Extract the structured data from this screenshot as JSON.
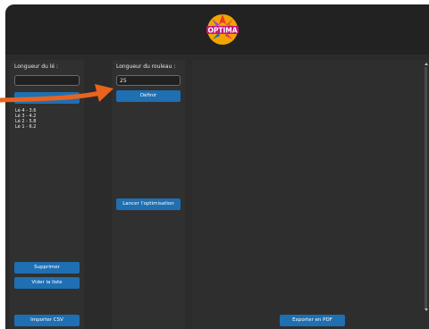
{
  "header": {
    "logo_text": "OPTIMA"
  },
  "left_panel": {
    "length_label": "Longueur du lé :",
    "length_value": "",
    "items": [
      "Lé 4 - 3.6",
      "Lé 3 - 4.2",
      "Lé 2 - 5.8",
      "Lé 1 - 6.2"
    ],
    "delete_label": "Supprimer",
    "clear_label": "Vider la liste",
    "import_label": "Importer CSV"
  },
  "middle_panel": {
    "roll_label": "Longueur du rouleau :",
    "roll_value": "25",
    "define_label": "Définir",
    "optimize_label": "Lancer l'optimisation"
  },
  "right_panel": {
    "export_label": "Exporter en PDF"
  },
  "colors": {
    "accent": "#1f6fb3",
    "annotation_arrow": "#e8641e",
    "background": "#2b2b2b"
  }
}
